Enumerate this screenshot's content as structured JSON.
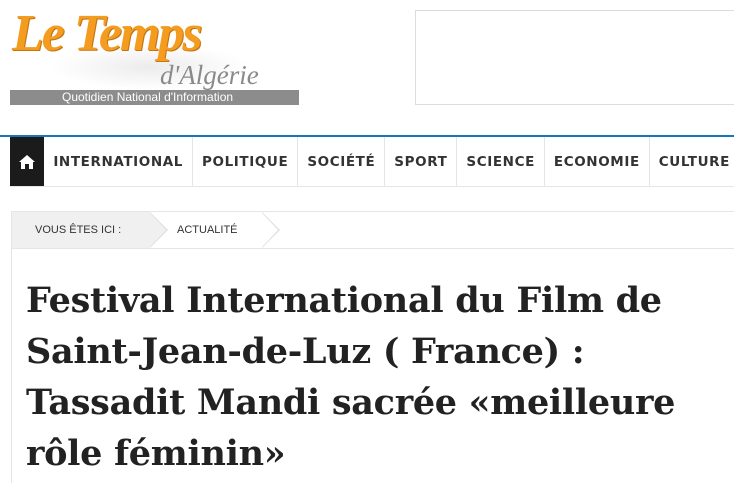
{
  "brand": {
    "title": "Le Temps",
    "subtitle": "d'Algérie",
    "tagline": "Quotidien National d'Information",
    "accent_color": "#f39c1f"
  },
  "nav": {
    "home_icon": "home-icon",
    "items": [
      {
        "label": "INTERNATIONAL"
      },
      {
        "label": "POLITIQUE"
      },
      {
        "label": "SOCIÉTÉ"
      },
      {
        "label": "SPORT"
      },
      {
        "label": "SCIENCE"
      },
      {
        "label": "ECONOMIE"
      },
      {
        "label": "CULTURE"
      }
    ],
    "accent_color": "#1b75bb"
  },
  "breadcrumb": {
    "prefix": "VOUS ÊTES ICI :",
    "current": "ACTUALITÉ"
  },
  "article": {
    "title": "Festival International du Film de Saint-Jean-de-Luz ( France) : Tassadit Mandi sacrée «meilleure rôle féminin»"
  }
}
